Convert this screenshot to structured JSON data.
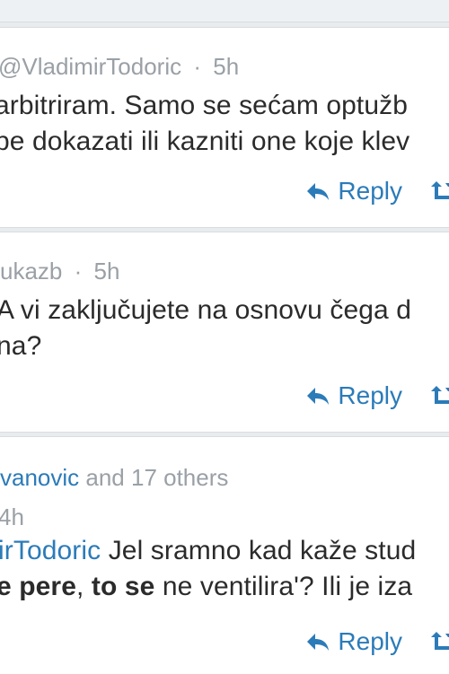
{
  "tweets": [
    {
      "handle": "@VladimirTodoric",
      "separator": "·",
      "time": "5h",
      "lines": [
        "arbitriram. Samo se sećam optužb",
        "be dokazati ili kazniti one koje klev"
      ],
      "reply_label": "Reply"
    },
    {
      "handle": "ukazb",
      "separator": "·",
      "time": "5h",
      "lines": [
        "A vi zaključujete na osnovu čega d",
        "na?"
      ],
      "reply_label": "Reply"
    },
    {
      "mentions_name": "vanovic",
      "mentions_rest": " and 17 others",
      "time": "4h",
      "line1_link": "irTodoric",
      "line1_rest": " Jel sramno kad kaže stud",
      "line2_b1": "e pere",
      "line2_p1": ", ",
      "line2_b2": "to se",
      "line2_p2": " ne ventilira'? Ili je iza",
      "reply_label": "Reply"
    }
  ],
  "colors": {
    "link": "#2b7bb9",
    "meta": "#9aa0a6",
    "text": "#2b2b2b",
    "background": "#e9ecee"
  },
  "icons": [
    "reply-arrow-icon",
    "retweet-icon"
  ]
}
